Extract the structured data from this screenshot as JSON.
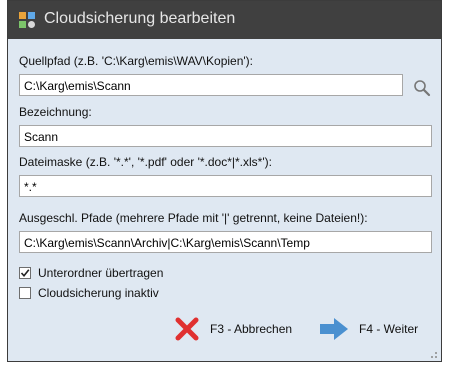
{
  "window": {
    "title": "Cloudsicherung bearbeiten",
    "icon": "cloud-backup-icon"
  },
  "fields": {
    "source_label": "Quellpfad (z.B. 'C:\\Karg\\emis\\WAV\\Kopien'):",
    "source_value": "C:\\Karg\\emis\\Scann",
    "name_label": "Bezeichnung:",
    "name_value": "Scann",
    "mask_label": "Dateimaske (z.B. '*.*', '*.pdf' oder '*.doc*|*.xls*'):",
    "mask_value": "*.*",
    "exclude_label": "Ausgeschl. Pfade (mehrere Pfade mit '|' getrennt, keine Dateien!):",
    "exclude_value": "C:\\Karg\\emis\\Scann\\Archiv|C:\\Karg\\emis\\Scann\\Temp"
  },
  "options": {
    "subfolders_label": "Unterordner übertragen",
    "subfolders_checked": true,
    "inactive_label": "Cloudsicherung inaktiv",
    "inactive_checked": false
  },
  "buttons": {
    "cancel_label": "F3 - Abbrechen",
    "next_label": "F4 - Weiter"
  },
  "colors": {
    "titlebar": "#404040",
    "dialog_bg": "#dfe8f2",
    "cancel_icon": "#e03030",
    "next_icon": "#4a90d0"
  }
}
